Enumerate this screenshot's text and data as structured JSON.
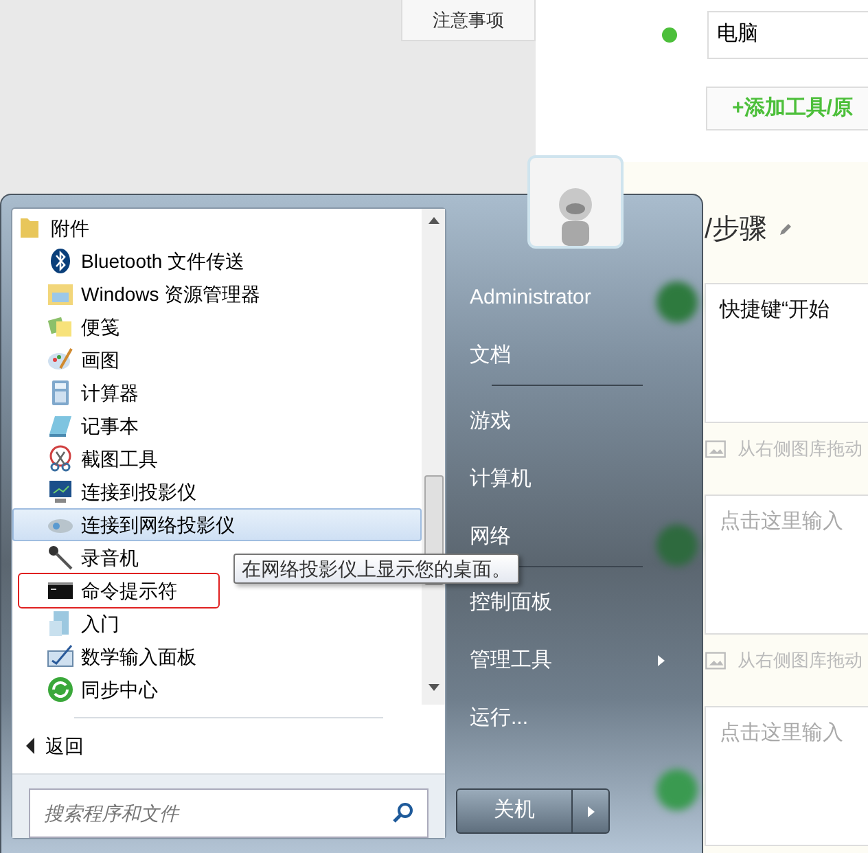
{
  "page": {
    "tab": "注意事项",
    "tools": [
      {
        "label": "电脑",
        "color": "#4cbf3a"
      }
    ],
    "add_button": "+添加工具/原",
    "section_title": "/步骤",
    "steps": [
      {
        "value": "快捷键“开始",
        "hint": "从右侧图库拖动"
      },
      {
        "placeholder": "点击这里输入",
        "hint": "从右侧图库拖动"
      },
      {
        "placeholder": "点击这里输入"
      }
    ]
  },
  "start_menu": {
    "programs": [
      {
        "label": "附件",
        "kind": "folder",
        "selected": false,
        "marked": false
      },
      {
        "label": "Bluetooth 文件传送",
        "kind": "program",
        "selected": false,
        "marked": false
      },
      {
        "label": "Windows 资源管理器",
        "kind": "program",
        "selected": false,
        "marked": false
      },
      {
        "label": "便笺",
        "kind": "program",
        "selected": false,
        "marked": false
      },
      {
        "label": "画图",
        "kind": "program",
        "selected": false,
        "marked": false
      },
      {
        "label": "计算器",
        "kind": "program",
        "selected": false,
        "marked": false
      },
      {
        "label": "记事本",
        "kind": "program",
        "selected": false,
        "marked": false
      },
      {
        "label": "截图工具",
        "kind": "program",
        "selected": false,
        "marked": false
      },
      {
        "label": "连接到投影仪",
        "kind": "program",
        "selected": false,
        "marked": false
      },
      {
        "label": "连接到网络投影仪",
        "kind": "program",
        "selected": true,
        "marked": false
      },
      {
        "label": "录音机",
        "kind": "program",
        "selected": false,
        "marked": false
      },
      {
        "label": "命令提示符",
        "kind": "program",
        "selected": false,
        "marked": true
      },
      {
        "label": "入门",
        "kind": "program",
        "selected": false,
        "marked": false
      },
      {
        "label": "数学输入面板",
        "kind": "program",
        "selected": false,
        "marked": false
      },
      {
        "label": "同步中心",
        "kind": "program",
        "selected": false,
        "marked": false
      }
    ],
    "back": "返回",
    "search": {
      "placeholder": "搜索程序和文件"
    },
    "places": [
      {
        "label": "Administrator",
        "separator_after": false,
        "has_submenu": false
      },
      {
        "label": "文档",
        "separator_after": true,
        "has_submenu": false
      },
      {
        "label": "游戏",
        "separator_after": false,
        "has_submenu": false
      },
      {
        "label": "计算机",
        "separator_after": false,
        "has_submenu": false
      },
      {
        "label": "网络",
        "separator_after": true,
        "has_submenu": false
      },
      {
        "label": "控制面板",
        "separator_after": false,
        "has_submenu": false
      },
      {
        "label": "管理工具",
        "separator_after": false,
        "has_submenu": true
      },
      {
        "label": "运行...",
        "separator_after": false,
        "has_submenu": false
      }
    ],
    "shutdown": "关机",
    "tooltip": "在网络投影仪上显示您的桌面。"
  }
}
